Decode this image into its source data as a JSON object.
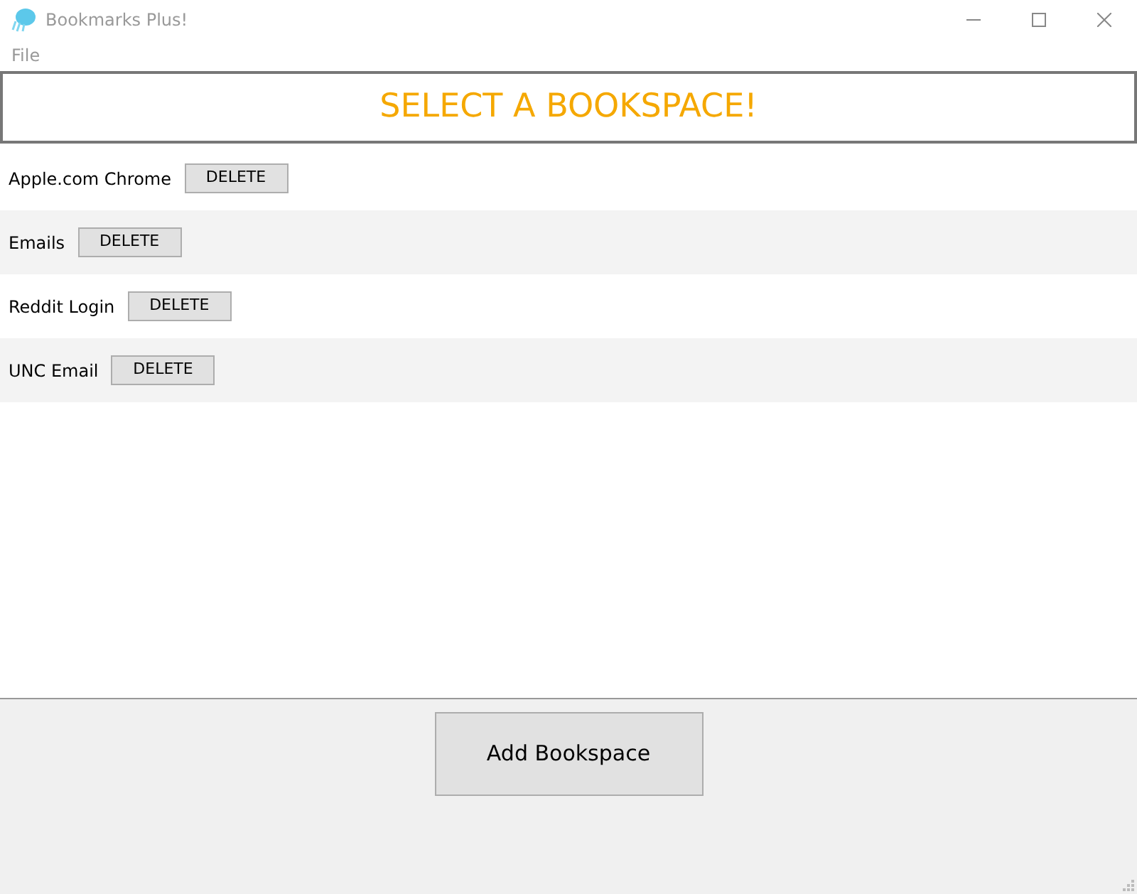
{
  "window": {
    "title": "Bookmarks Plus!"
  },
  "menu": [
    "File"
  ],
  "header": "SELECT A BOOKSPACE!",
  "bookspaces": [
    {
      "name": "Apple.com Chrome",
      "button": "DELETE"
    },
    {
      "name": "Emails",
      "button": "DELETE"
    },
    {
      "name": "Reddit Login",
      "button": "DELETE"
    },
    {
      "name": "UNC Email",
      "button": "DELETE"
    }
  ],
  "add_button": "Add Bookspace"
}
